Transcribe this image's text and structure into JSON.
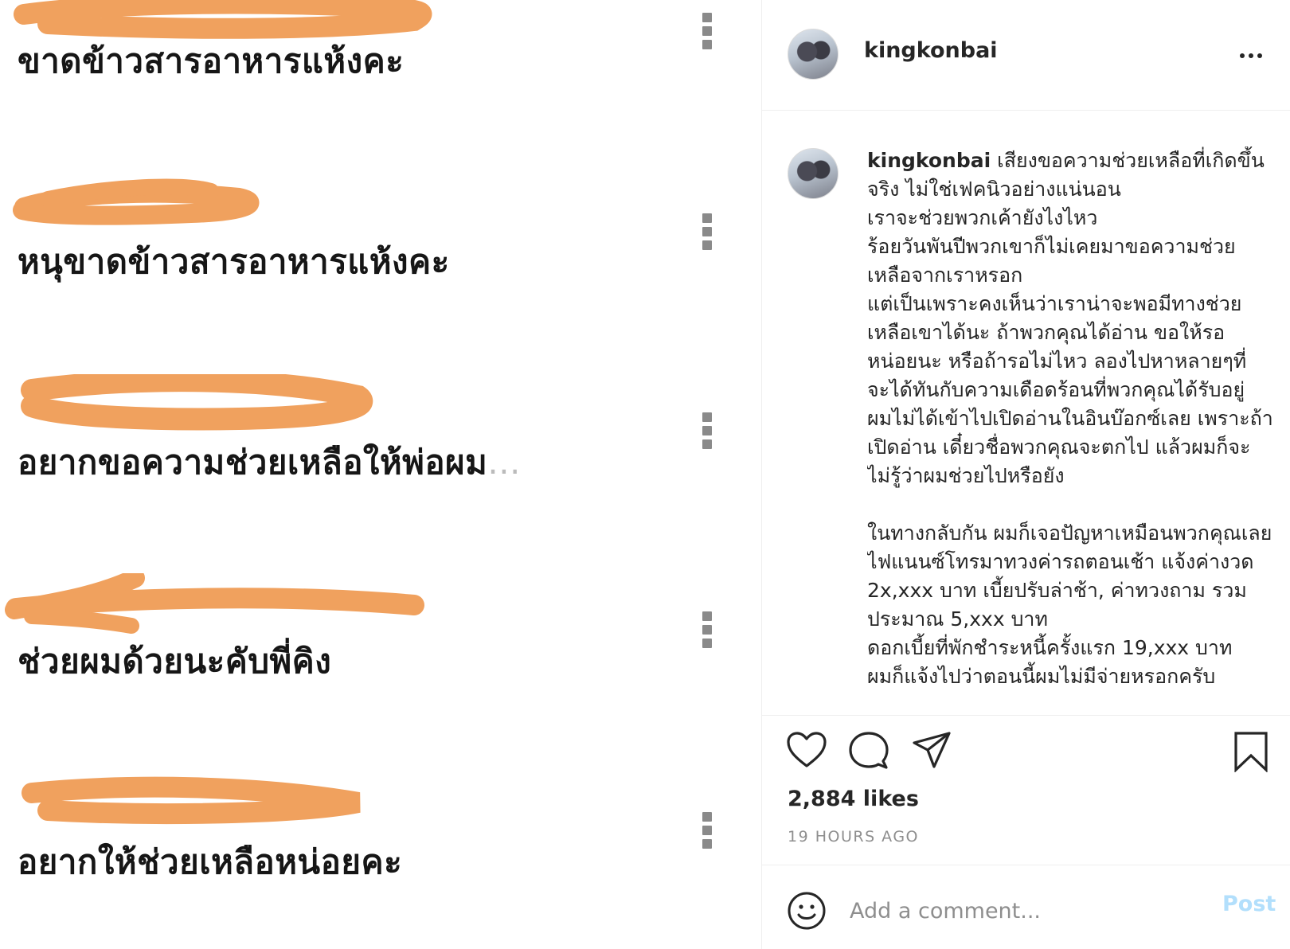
{
  "left_image": {
    "messages": [
      {
        "text": "ขาดข้าวสารอาหารแห้งคะ",
        "ellipsis": ""
      },
      {
        "text": "หนุขาดข้าวสารอาหารแห้งคะ",
        "ellipsis": ""
      },
      {
        "text": "อยากขอความช่วยเหลือให้พ่อผม",
        "ellipsis": "..."
      },
      {
        "text": "ช่วยผมด้วยนะคับพี่คิง",
        "ellipsis": ""
      },
      {
        "text": "อยากให้ช่วยเหลือหน่อยคะ",
        "ellipsis": ""
      }
    ],
    "redaction_color": "#F0A15E"
  },
  "post": {
    "username": "kingkonbai",
    "caption_lines": [
      "เสียงขอความช่วยเหลือที่เกิดขึ้นจริง ไม่ใช่เฟคนิวอย่างแน่นอน",
      "เราจะช่วยพวกเค้ายังไงไหว",
      "ร้อยวันพันปีพวกเขาก็ไม่เคยมาขอความช่วยเหลือจากเราหรอก",
      "แต่เป็นเพราะคงเห็นว่าเราน่าจะพอมีทางช่วยเหลือเขาได้นะ ถ้าพวกคุณได้อ่าน ขอให้รอหน่อยนะ หรือถ้ารอไม่ไหว ลองไปหาหลายๆที่ จะได้ทันกับความเดือดร้อนที่พวกคุณได้รับอยู่",
      "ผมไม่ได้เข้าไปเปิดอ่านในอินบ๊อกซ์เลย เพราะถ้าเปิดอ่าน เดี๋ยวชื่อพวกคุณจะตกไป แล้วผมก็จะไม่รู้ว่าผมช่วยไปหรือยัง",
      "",
      "ในทางกลับกัน ผมก็เจอปัญหาเหมือนพวกคุณเลย",
      "ไฟแนนซ์โทรมาทวงค่ารถตอนเช้า แจ้งค่างวด 2x,xxx บาท เบี้ยปรับล่าช้า, ค่าทวงถาม รวมประมาณ 5,xxx บาท",
      "ดอกเบี้ยที่พักชำระหนี้ครั้งแรก 19,xxx บาท",
      "ผมก็แจ้งไปว่าตอนนี้ผมไม่มีจ่ายหรอกครับ"
    ],
    "likes": "2,884 likes",
    "timestamp": "19 HOURS AGO"
  },
  "comment_box": {
    "placeholder": "Add a comment...",
    "post_label": "Post"
  },
  "icons": {
    "header_more": "more-horizontal-icon",
    "message_more": "more-vertical-icon",
    "like": "heart-icon",
    "comment": "comment-bubble-icon",
    "share": "paper-plane-icon",
    "save": "bookmark-icon",
    "emoji": "smiley-icon"
  },
  "colors": {
    "post_button_disabled": "#B2DFFC",
    "muted_text": "#8E8E8E"
  }
}
